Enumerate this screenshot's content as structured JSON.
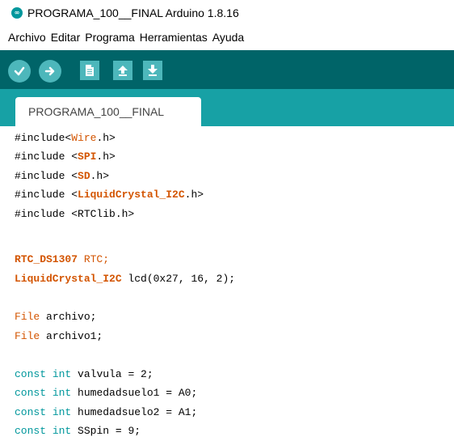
{
  "window": {
    "title": "PROGRAMA_100__FINAL Arduino 1.8.16"
  },
  "menu": [
    "Archivo",
    "Editar",
    "Programa",
    "Herramientas",
    "Ayuda"
  ],
  "toolbar": {
    "buttons": [
      "verify-icon",
      "upload-icon",
      "new-icon",
      "open-icon",
      "save-icon"
    ]
  },
  "tab": {
    "label": "PROGRAMA_100__FINAL"
  },
  "code": {
    "l1": {
      "a": "#include<",
      "b": "Wire",
      ".": ".h>"
    },
    "l2": {
      "a": "#include <",
      "b": "SPI",
      "c": ".h>"
    },
    "l3": {
      "a": "#include <",
      "b": "SD",
      "c": ".h>"
    },
    "l4": {
      "a": "#include <",
      "b": "LiquidCrystal_I2C",
      "c": ".h>"
    },
    "l5": {
      "a": "#include <RTClib.h>"
    },
    "l6": {
      "a": "RTC_DS1307",
      "b": " RTC;"
    },
    "l7": {
      "a": "LiquidCrystal_I2C",
      "b": " lcd(0x27, 16, 2);"
    },
    "l8": {
      "a": "File",
      "b": " archivo;"
    },
    "l9": {
      "a": "File",
      "b": " archivo1;"
    },
    "l10": {
      "a": "const",
      "b": " ",
      "c": "int",
      "d": " valvula = 2;"
    },
    "l11": {
      "a": "const",
      "b": " ",
      "c": "int",
      "d": " humedadsuelo1 = A0;"
    },
    "l12": {
      "a": "const",
      "b": " ",
      "c": "int",
      "d": " humedadsuelo2 = A1;"
    },
    "l13": {
      "a": "const",
      "b": " ",
      "c": "int",
      "d": " SSpin = 9;"
    }
  },
  "colors": {
    "toolbar": "#006468",
    "tabbar": "#17a1a5",
    "button": "#4db7bb",
    "keyword_class": "#d35400",
    "keyword_type": "#00979c"
  }
}
